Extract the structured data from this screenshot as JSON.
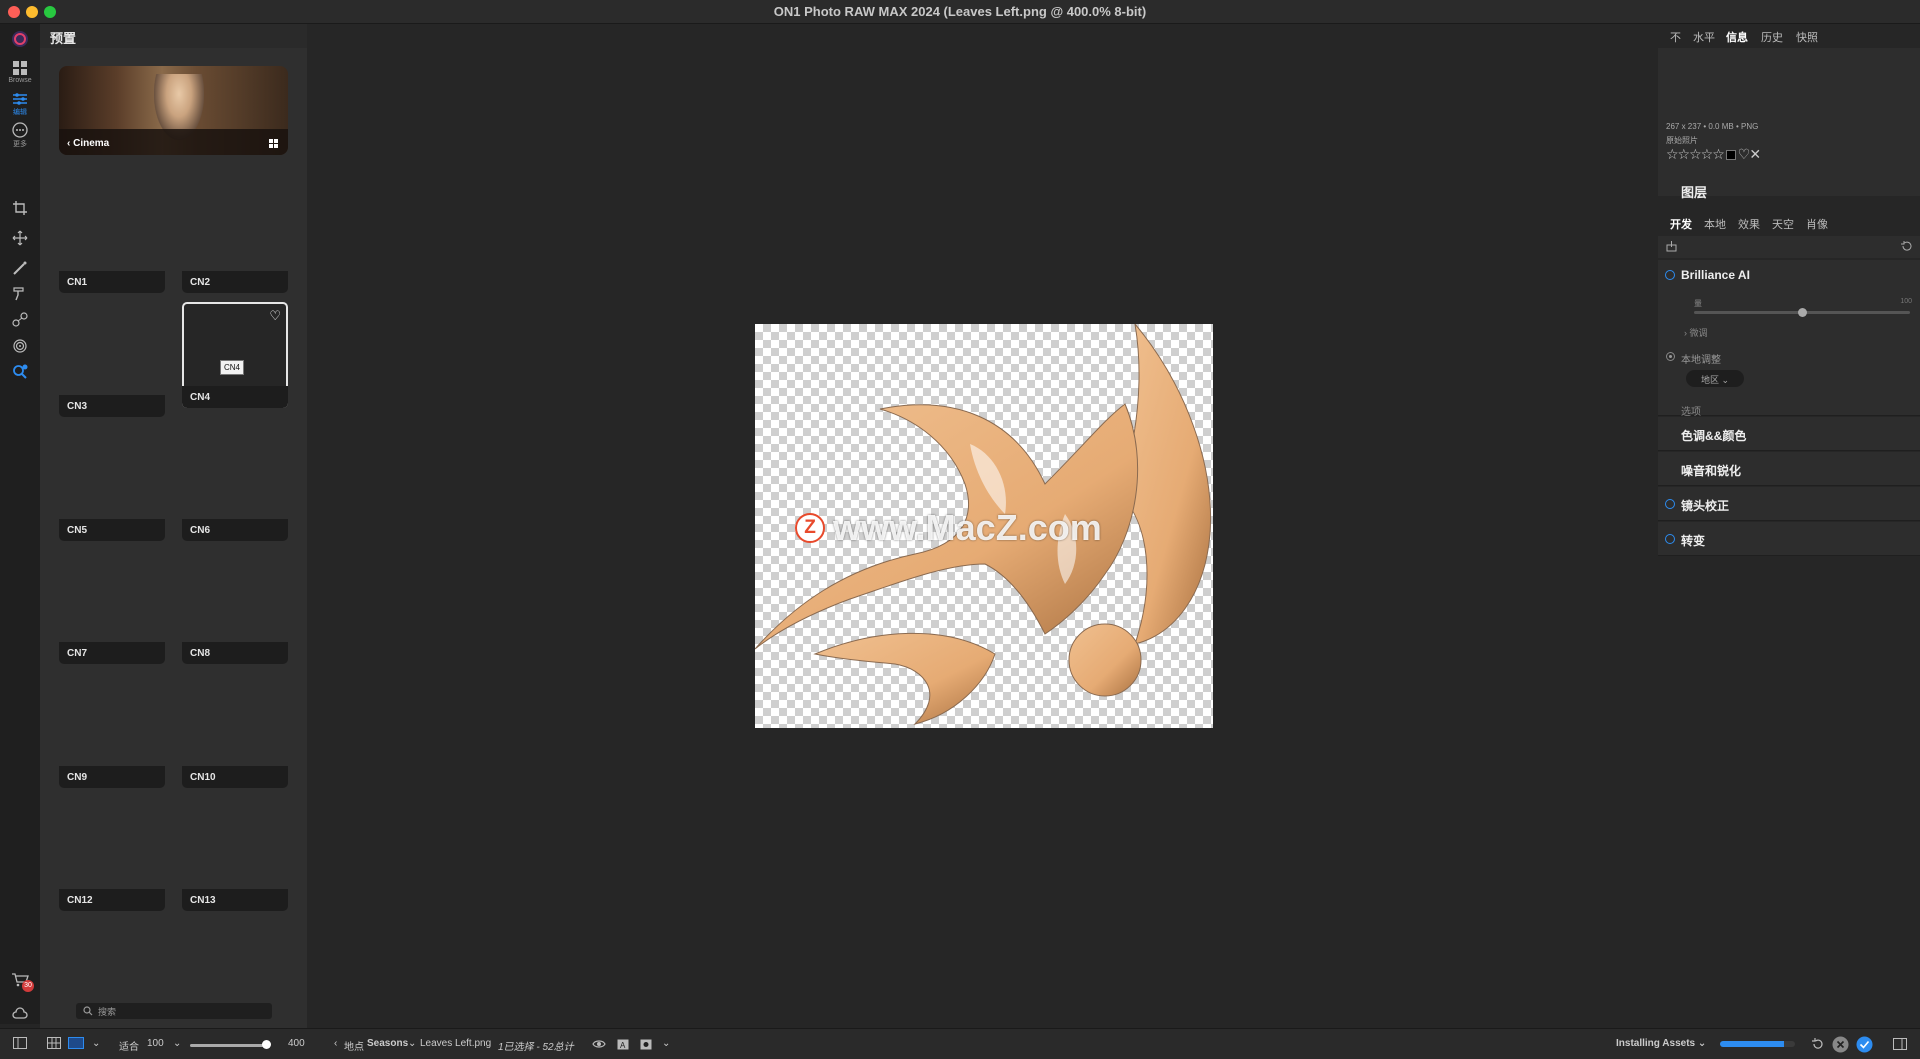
{
  "window": {
    "title": "ON1 Photo RAW MAX 2024 (Leaves Left.png @ 400.0% 8-bit)"
  },
  "toolrail": {
    "browse_label": "Browse",
    "edit_label": "编辑",
    "more_label": "更多",
    "cart_badge": "30"
  },
  "left_panel": {
    "title": "预置",
    "category": "Cinema",
    "presets": [
      {
        "label": "CN1"
      },
      {
        "label": "CN2"
      },
      {
        "label": "CN3"
      },
      {
        "label": "CN4",
        "selected": true,
        "tooltip": "CN4"
      },
      {
        "label": "CN5"
      },
      {
        "label": "CN6"
      },
      {
        "label": "CN7"
      },
      {
        "label": "CN8"
      },
      {
        "label": "CN9"
      },
      {
        "label": "CN10"
      },
      {
        "label": "CN12"
      },
      {
        "label": "CN13"
      }
    ],
    "search_placeholder": "搜索"
  },
  "canvas": {
    "watermark_logo": "Z",
    "watermark_text": "www.MacZ.com",
    "image_fill": "#e8b07e"
  },
  "right_panel": {
    "tabs": [
      {
        "label": "不"
      },
      {
        "label": "水平"
      },
      {
        "label": "信息",
        "active": true
      },
      {
        "label": "历史"
      },
      {
        "label": "快照"
      }
    ],
    "info": {
      "meta": "267 x 237 • 0.0 MB • PNG",
      "source": "原始照片",
      "rating_stars": "☆☆☆☆☆",
      "flag_icons": "♡✕"
    },
    "layers_title": "图层",
    "subtabs": [
      {
        "label": "开发",
        "active": true
      },
      {
        "label": "本地"
      },
      {
        "label": "效果"
      },
      {
        "label": "天空"
      },
      {
        "label": "肖像"
      }
    ],
    "brilliance": {
      "title": "Brilliance AI",
      "slider_label": "量",
      "slider_max": "100",
      "slider_value": 50,
      "fine_tune": "微调",
      "local_adjust": "本地调整",
      "region": "地区",
      "options": "选项"
    },
    "modules": [
      "色调&&颜色",
      "噪音和锐化",
      "镜头校正",
      "转变"
    ]
  },
  "statusbar": {
    "fit_label": "适合",
    "fit_value": "100",
    "zoom_value": "400",
    "zoom_fraction": 0.95,
    "location_label": "地点",
    "folder": "Seasons",
    "filename": "Leaves Left.png",
    "selection": "1已选择 - 52总计",
    "installing": "Installing Assets",
    "progress": 0.85
  },
  "colors": {
    "accent": "#2d8cf0",
    "image": "#e8b07e"
  }
}
